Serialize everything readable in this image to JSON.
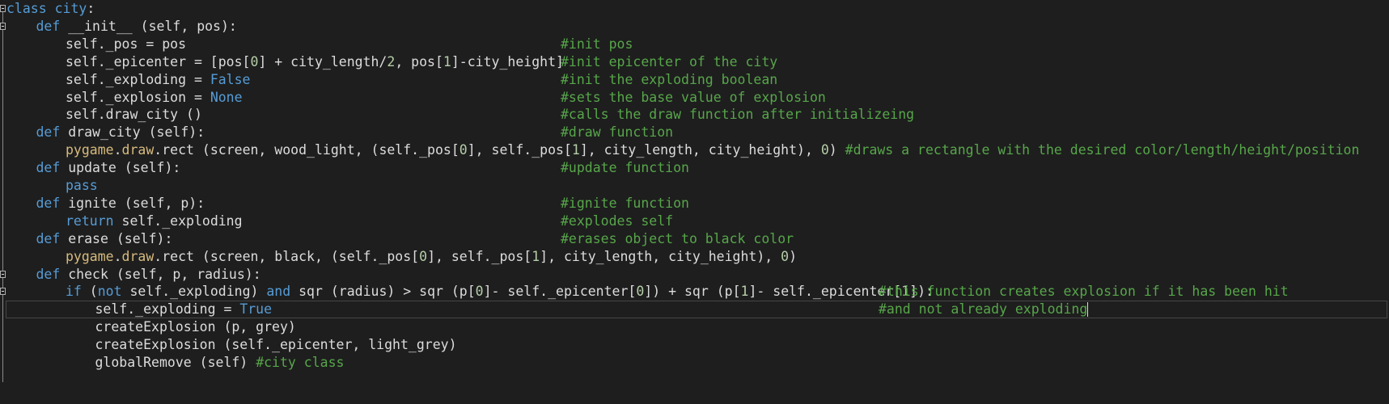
{
  "editor": {
    "language": "python",
    "colors": {
      "background": "#1e1e1e",
      "text": "#dcdcdc",
      "keyword": "#569cd6",
      "comment": "#57a64a",
      "number": "#b5cea8",
      "module": "#d7ba7d"
    },
    "active_line": 17,
    "lines": [
      {
        "indent": 0,
        "tokens": [
          {
            "type": "k",
            "text": "class"
          },
          {
            "type": "t",
            "text": " "
          },
          {
            "type": "k",
            "text": "city"
          },
          {
            "type": "t",
            "text": ":"
          }
        ]
      },
      {
        "indent": 1,
        "tokens": [
          {
            "type": "k",
            "text": "def"
          },
          {
            "type": "t",
            "text": " __init__ (self, pos):"
          }
        ]
      },
      {
        "indent": 2,
        "comment": "#init pos",
        "tokens": [
          {
            "type": "t",
            "text": "self._pos = pos"
          }
        ]
      },
      {
        "indent": 2,
        "comment": "#init epicenter of the city",
        "tokens": [
          {
            "type": "t",
            "text": "self._epicenter = [pos["
          },
          {
            "type": "n",
            "text": "0"
          },
          {
            "type": "t",
            "text": "] + city_length/"
          },
          {
            "type": "n",
            "text": "2"
          },
          {
            "type": "t",
            "text": ", pos["
          },
          {
            "type": "n",
            "text": "1"
          },
          {
            "type": "t",
            "text": "]-city_height]"
          }
        ]
      },
      {
        "indent": 2,
        "comment": "#init the exploding boolean",
        "tokens": [
          {
            "type": "t",
            "text": "self._exploding = "
          },
          {
            "type": "k",
            "text": "False"
          }
        ]
      },
      {
        "indent": 2,
        "comment": "#sets the base value of explosion",
        "tokens": [
          {
            "type": "t",
            "text": "self._explosion = "
          },
          {
            "type": "k",
            "text": "None"
          }
        ]
      },
      {
        "indent": 2,
        "comment": "#calls the draw function after initializeing",
        "tokens": [
          {
            "type": "t",
            "text": "self.draw_city ()"
          }
        ]
      },
      {
        "indent": 1,
        "comment": "#draw function",
        "tokens": [
          {
            "type": "k",
            "text": "def"
          },
          {
            "type": "t",
            "text": " draw_city (self):"
          }
        ]
      },
      {
        "indent": 2,
        "tokens": [
          {
            "type": "f",
            "text": "pygame"
          },
          {
            "type": "t",
            "text": "."
          },
          {
            "type": "f",
            "text": "draw"
          },
          {
            "type": "t",
            "text": ".rect (screen, wood_light, (self._pos["
          },
          {
            "type": "n",
            "text": "0"
          },
          {
            "type": "t",
            "text": "], self._pos["
          },
          {
            "type": "n",
            "text": "1"
          },
          {
            "type": "t",
            "text": "], city_length, city_height), "
          },
          {
            "type": "n",
            "text": "0"
          },
          {
            "type": "t",
            "text": ") "
          },
          {
            "type": "c",
            "text": "#draws a rectangle with the desired color/length/height/position"
          }
        ]
      },
      {
        "indent": 1,
        "comment": "#update function",
        "tokens": [
          {
            "type": "k",
            "text": "def"
          },
          {
            "type": "t",
            "text": " update (self):"
          }
        ]
      },
      {
        "indent": 2,
        "tokens": [
          {
            "type": "k",
            "text": "pass"
          }
        ]
      },
      {
        "indent": 1,
        "comment": "#ignite function",
        "tokens": [
          {
            "type": "k",
            "text": "def"
          },
          {
            "type": "t",
            "text": " ignite (self, p):"
          }
        ]
      },
      {
        "indent": 2,
        "comment": "#explodes self",
        "tokens": [
          {
            "type": "k",
            "text": "return"
          },
          {
            "type": "t",
            "text": " self._exploding"
          }
        ]
      },
      {
        "indent": 1,
        "comment": "#erases object to black color",
        "tokens": [
          {
            "type": "k",
            "text": "def"
          },
          {
            "type": "t",
            "text": " erase (self):"
          }
        ]
      },
      {
        "indent": 2,
        "tokens": [
          {
            "type": "f",
            "text": "pygame"
          },
          {
            "type": "t",
            "text": "."
          },
          {
            "type": "f",
            "text": "draw"
          },
          {
            "type": "t",
            "text": ".rect (screen, black, (self._pos["
          },
          {
            "type": "n",
            "text": "0"
          },
          {
            "type": "t",
            "text": "], self._pos["
          },
          {
            "type": "n",
            "text": "1"
          },
          {
            "type": "t",
            "text": "], city_length, city_height), "
          },
          {
            "type": "n",
            "text": "0"
          },
          {
            "type": "t",
            "text": ")"
          }
        ]
      },
      {
        "indent": 1,
        "tokens": [
          {
            "type": "k",
            "text": "def"
          },
          {
            "type": "t",
            "text": " check (self, p, radius):"
          }
        ]
      },
      {
        "indent": 2,
        "comment2": "#this function creates explosion if it has been hit",
        "tokens": [
          {
            "type": "k",
            "text": "if"
          },
          {
            "type": "t",
            "text": " ("
          },
          {
            "type": "k",
            "text": "not"
          },
          {
            "type": "t",
            "text": " self._exploding) "
          },
          {
            "type": "k",
            "text": "and"
          },
          {
            "type": "t",
            "text": " sqr (radius) > sqr (p["
          },
          {
            "type": "n",
            "text": "0"
          },
          {
            "type": "t",
            "text": "]- self._epicenter["
          },
          {
            "type": "n",
            "text": "0"
          },
          {
            "type": "t",
            "text": "]) + sqr (p["
          },
          {
            "type": "n",
            "text": "1"
          },
          {
            "type": "t",
            "text": "]- self._epicenter["
          },
          {
            "type": "n",
            "text": "1"
          },
          {
            "type": "t",
            "text": "]):"
          }
        ]
      },
      {
        "indent": 3,
        "comment2": "#and not already exploding",
        "tokens": [
          {
            "type": "t",
            "text": "self._exploding = "
          },
          {
            "type": "k",
            "text": "True"
          }
        ]
      },
      {
        "indent": 3,
        "tokens": [
          {
            "type": "t",
            "text": "createExplosion (p, grey)"
          }
        ]
      },
      {
        "indent": 3,
        "tokens": [
          {
            "type": "t",
            "text": "createExplosion (self._epicenter, light_grey)"
          }
        ]
      },
      {
        "indent": 3,
        "tokens": [
          {
            "type": "t",
            "text": "globalRemove (self) "
          },
          {
            "type": "c",
            "text": "#city class"
          }
        ]
      }
    ]
  }
}
